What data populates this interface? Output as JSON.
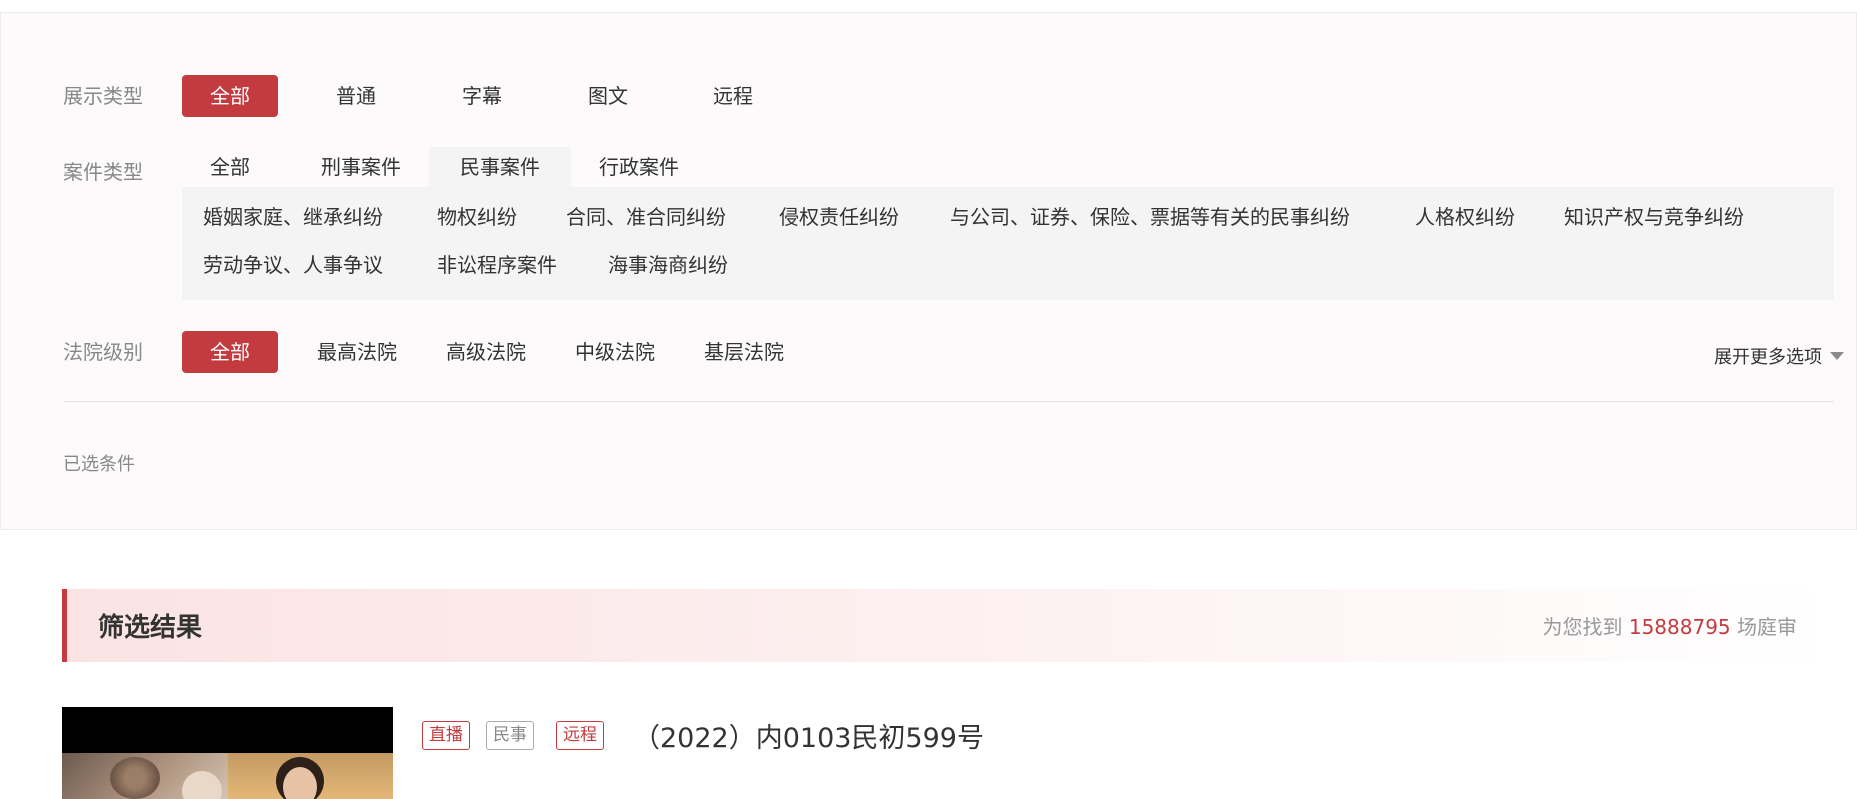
{
  "filters": {
    "display_type": {
      "label": "展示类型",
      "options": [
        "全部",
        "普通",
        "字幕",
        "图文",
        "远程"
      ],
      "selected": "全部"
    },
    "case_type": {
      "label": "案件类型",
      "tabs": [
        "全部",
        "刑事案件",
        "民事案件",
        "行政案件"
      ],
      "active_tab": "民事案件",
      "sub_options": [
        "婚姻家庭、继承纠纷",
        "物权纠纷",
        "合同、准合同纠纷",
        "侵权责任纠纷",
        "与公司、证券、保险、票据等有关的民事纠纷",
        "人格权纠纷",
        "知识产权与竞争纠纷",
        "劳动争议、人事争议",
        "非讼程序案件",
        "海事海商纠纷"
      ]
    },
    "court_level": {
      "label": "法院级别",
      "options": [
        "全部",
        "最高法院",
        "高级法院",
        "中级法院",
        "基层法院"
      ],
      "selected": "全部"
    },
    "expand_label": "展开更多选项",
    "selected_conditions_label": "已选条件"
  },
  "results": {
    "title": "筛选结果",
    "count_prefix": "为您找到",
    "count": "15888795",
    "count_suffix": "场庭审"
  },
  "first_result": {
    "tags": [
      "直播",
      "民事",
      "远程"
    ],
    "case_number": "（2022）内0103民初599号"
  },
  "colors": {
    "accent": "#c33b3f",
    "panel_bg": "#fdfafb",
    "sub_bg": "#f4f4f4",
    "muted_text": "#888888"
  }
}
